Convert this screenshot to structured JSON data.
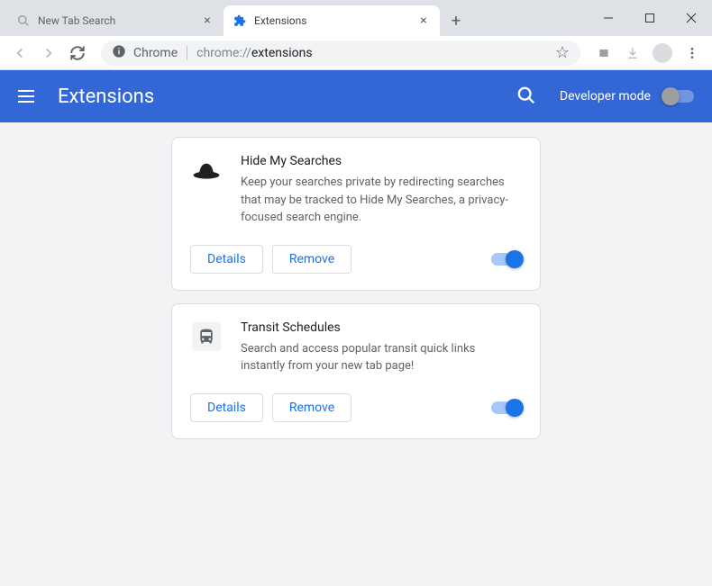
{
  "tabs": [
    {
      "title": "New Tab Search",
      "active": false
    },
    {
      "title": "Extensions",
      "active": true
    }
  ],
  "toolbar": {
    "chrome_label": "Chrome",
    "url_prefix": "chrome://",
    "url_suffix": "extensions"
  },
  "header": {
    "title": "Extensions",
    "developer_mode_label": "Developer mode"
  },
  "extensions": [
    {
      "name": "Hide My Searches",
      "description": "Keep your searches private by redirecting searches that may be tracked to Hide My Searches, a privacy-focused search engine.",
      "details_label": "Details",
      "remove_label": "Remove",
      "enabled": true,
      "icon": "hat"
    },
    {
      "name": "Transit Schedules",
      "description": "Search and access popular transit quick links instantly from your new tab page!",
      "details_label": "Details",
      "remove_label": "Remove",
      "enabled": true,
      "icon": "bus"
    }
  ]
}
